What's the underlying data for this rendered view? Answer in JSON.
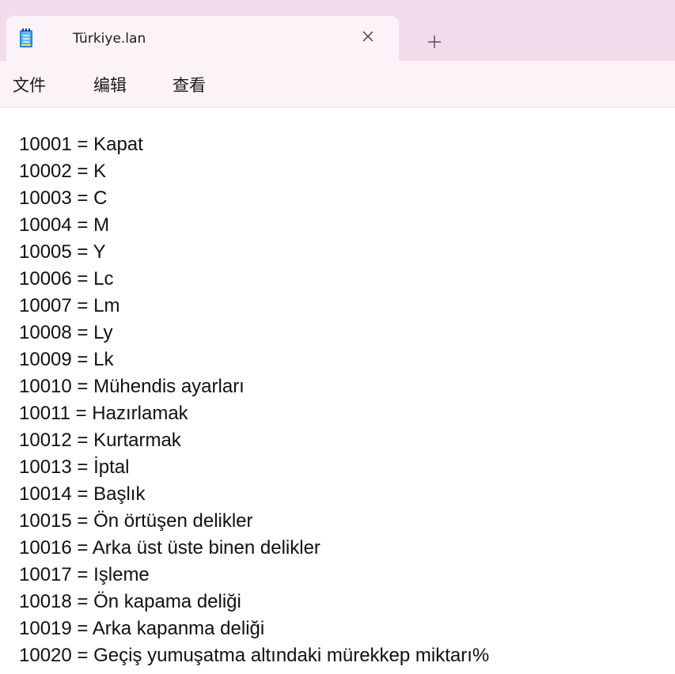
{
  "window": {
    "tab_title": "Türkiye.lan",
    "close_glyph": "✕",
    "new_tab_glyph": "+"
  },
  "menu": {
    "items": [
      "文件",
      "编辑",
      "查看"
    ]
  },
  "editor": {
    "lines": [
      "10001 = Kapat",
      "10002 = K",
      "10003 = C",
      "10004 = M",
      "10005 = Y",
      "10006 = Lc",
      "10007 = Lm",
      "10008 = Ly",
      "10009 = Lk",
      "10010 = Mühendis ayarları",
      "10011 = Hazırlamak",
      "10012 = Kurtarmak",
      "10013 = İptal",
      "10014 = Başlık",
      "10015 = Ön örtüşen delikler",
      "10016 = Arka üst üste binen delikler",
      "10017 = Işleme",
      "10018 = Ön kapama deliği",
      "10019 = Arka kapanma deliği",
      "10020 = Geçiş yumuşatma altındaki mürekkep miktarı%"
    ]
  },
  "colors": {
    "titlebar": "#f2dcec",
    "tab": "#fbf3f8",
    "icon": "#1e88e5"
  }
}
